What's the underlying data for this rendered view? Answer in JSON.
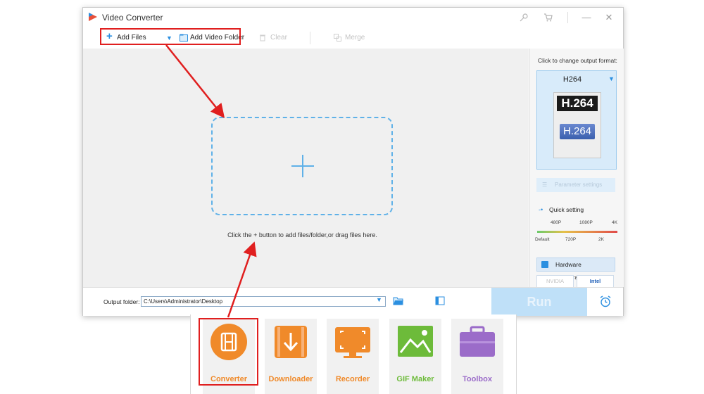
{
  "window": {
    "title": "Video Converter",
    "controls": {
      "minimize": "—",
      "close": "✕"
    }
  },
  "toolbar": {
    "add_files": "Add Files",
    "add_video_folder": "Add Video Folder",
    "clear": "Clear",
    "merge": "Merge"
  },
  "workspace": {
    "hint": "Click the + button to add files/folder,or drag files here."
  },
  "right_panel": {
    "output_format_label": "Click to change output format:",
    "format_name": "H264",
    "format_badge_top": "H.264",
    "format_badge_bottom": "H.264",
    "parameter_settings": "Parameter settings",
    "quick_setting": "Quick setting",
    "quality_top_ticks": [
      "480P",
      "1080P",
      "4K"
    ],
    "quality_bottom_ticks": [
      "Default",
      "720P",
      "2K"
    ],
    "hardware_acceleration": "Hardware acceleration",
    "gpu_nvidia": "NVIDIA",
    "gpu_intel": "Intel"
  },
  "bottom_bar": {
    "output_folder_label": "Output folder:",
    "output_path": "C:\\Users\\Administrator\\Desktop",
    "run": "Run"
  },
  "dock": {
    "items": [
      {
        "label": "Converter",
        "color": "#f08a2a"
      },
      {
        "label": "Downloader",
        "color": "#f08a2a"
      },
      {
        "label": "Recorder",
        "color": "#f08a2a"
      },
      {
        "label": "GIF Maker",
        "color": "#6dbb3a"
      },
      {
        "label": "Toolbox",
        "color": "#9b6cc9"
      }
    ]
  },
  "colors": {
    "accent": "#2b8fe0",
    "highlight": "#e01f1f",
    "dashed_border": "#5fb1e8"
  }
}
